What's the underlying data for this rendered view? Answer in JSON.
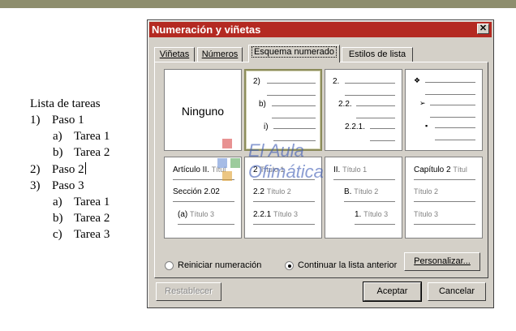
{
  "document": {
    "title": "Lista de tareas",
    "items": [
      {
        "num": "1)",
        "text": "Paso 1",
        "level": 1
      },
      {
        "num": "a)",
        "text": "Tarea 1",
        "level": 2
      },
      {
        "num": "b)",
        "text": "Tarea 2",
        "level": 2
      },
      {
        "num": "2)",
        "text": "Paso 2",
        "level": 1
      },
      {
        "num": "3)",
        "text": "Paso 3",
        "level": 1
      },
      {
        "num": "a)",
        "text": "Tarea 1",
        "level": 2
      },
      {
        "num": "b)",
        "text": "Tarea 2",
        "level": 2
      },
      {
        "num": "c)",
        "text": "Tarea 3",
        "level": 2
      }
    ]
  },
  "dialog": {
    "title": "Numeración y viñetas",
    "close_label": "✕",
    "tabs": [
      {
        "label": "Viñetas",
        "active": false
      },
      {
        "label": "Números",
        "active": false
      },
      {
        "label": "Esquema numerado",
        "active": true
      },
      {
        "label": "Estilos de lista",
        "active": false
      }
    ],
    "options": {
      "none": "Ninguno",
      "opt1": {
        "l1": "2)",
        "l2": "b)",
        "l3": "i)"
      },
      "opt2": {
        "l1": "2.",
        "l2": "2.2.",
        "l3": "2.2.1."
      },
      "opt3": {
        "l1": "❖",
        "l2": "➢",
        "l3": "▪"
      },
      "opt4": {
        "l1a": "Artículo II.",
        "l1b": "Títul",
        "l2a": "Sección 2.02",
        "l3a": "(a)",
        "l3b": "Título 3"
      },
      "opt5": {
        "l1a": "2",
        "l1b": "Título 1",
        "l2a": "2.2",
        "l2b": "Título 2",
        "l3a": "2.2.1",
        "l3b": "Título 3"
      },
      "opt6": {
        "l1a": "II.",
        "l1b": "Título 1",
        "l2a": "B.",
        "l2b": "Título 2",
        "l3a": "1.",
        "l3b": "Título 3"
      },
      "opt7": {
        "l1a": "Capítulo 2",
        "l1b": "Títul",
        "l2b": "Título 2",
        "l3b": "Título 3"
      }
    },
    "radio_restart": "Reiniciar numeración",
    "radio_continue": "Continuar la lista anterior",
    "customize": "Personalizar...",
    "reset": "Restablecer",
    "ok": "Aceptar",
    "cancel": "Cancelar"
  },
  "watermark": {
    "line1": "El Aula",
    "line2": "Ofimática"
  }
}
